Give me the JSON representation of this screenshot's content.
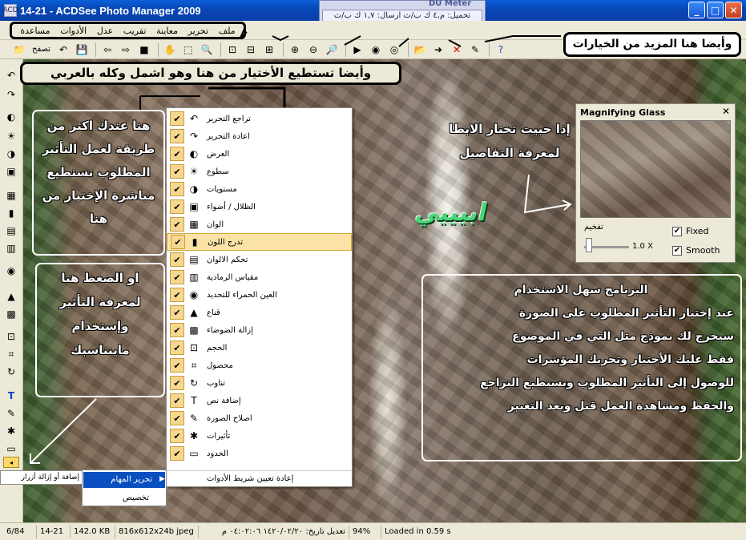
{
  "window": {
    "title": "14-21 - ACDSee Photo Manager 2009",
    "app_icon_label": "ACD",
    "minimize_symbol": "_",
    "maximize_symbol": "□",
    "close_symbol": "✕"
  },
  "du_meter": {
    "title": "DU Meter",
    "readout": "تحميل: م,٤ ك ب/ث ارسال: ١,٧ ك ب/ث"
  },
  "menu": {
    "items": [
      "مساعدة",
      "الأدوات",
      "عدل",
      "تقريب",
      "معاينة",
      "تحرير",
      "ملف"
    ]
  },
  "toolbar": {
    "browse_label": "تصفح",
    "icons": [
      "browse-icon",
      "rotate-left-icon",
      "save-icon",
      "back-icon",
      "forward-icon",
      "stop-icon",
      "hand-icon",
      "select-icon",
      "magnifier-icon",
      "fit-icon",
      "fit-width-icon",
      "actual-size-icon",
      "zoom-in-icon",
      "zoom-out-icon",
      "zoom-icon",
      "slideshow-icon",
      "wallpaper-icon",
      "info-icon",
      "open-folder-icon",
      "move-icon",
      "delete-icon",
      "properties-icon",
      "help-icon"
    ]
  },
  "annotations": {
    "more_options": "وأيضا هنا المزيد من الخيارات",
    "choose_here": "وأيضا تستطيع الأختيار من هنا وهو اشمل وكله بالعربي",
    "more_ways": [
      "هنا عندك اكثر من",
      "طريقة لعمل التأثير",
      "المطلوب تستطيع",
      "مباشرة الإختيار من",
      "هنا"
    ],
    "press_here": [
      "او الضغط هنا",
      "لمعرفة التأثير",
      "وإستخدام",
      "ماينناسبك"
    ],
    "easy": [
      "البرنامج سهل الاستخدام",
      "عند إختيار التأثير المطلوب على الصورة",
      "سيخرج لك نموذج مثل التي في الموضوع",
      "فقط عليك الأختيار وتحريك المؤشرات",
      "للوصول إلى التأثير المطلوب وتستطيع التراجع",
      "والحفظ ومشاهدة العمل قبل وبعد  التغيير"
    ],
    "magnifier_note": [
      "إذا حبيت تختار الابطا",
      "لمعرفة التفاصيل"
    ],
    "green_word": "ابيييي"
  },
  "dropdown": {
    "items": [
      {
        "label": "تراجع التحرير",
        "icon": "undo-icon"
      },
      {
        "label": "اعادة التحرير",
        "icon": "redo-icon"
      },
      {
        "label": "العرض",
        "icon": "exposure-icon"
      },
      {
        "label": "سطوع",
        "icon": "brightness-icon"
      },
      {
        "label": "مستويات",
        "icon": "levels-icon"
      },
      {
        "label": "الظلال / أضواء",
        "icon": "shadows-icon"
      },
      {
        "label": "الوان",
        "icon": "color-icon"
      },
      {
        "label": "تدرج اللون",
        "icon": "histogram-icon"
      },
      {
        "label": "تحكم الالوان",
        "icon": "color-control-icon"
      },
      {
        "label": "مقياس الرمادية",
        "icon": "grayscale-icon"
      },
      {
        "label": "العين الحمراء للتحديد",
        "icon": "red-eye-icon"
      },
      {
        "label": "قناع",
        "icon": "mask-icon"
      },
      {
        "label": "إزالة الضوضاء",
        "icon": "noise-icon"
      },
      {
        "label": "الحجم",
        "icon": "resize-icon"
      },
      {
        "label": "محصول",
        "icon": "crop-icon"
      },
      {
        "label": "تناوب",
        "icon": "rotate-icon"
      },
      {
        "label": "إضافة نص",
        "icon": "text-icon"
      },
      {
        "label": "اصلاح الصورة",
        "icon": "repair-icon"
      },
      {
        "label": "تأثيرات",
        "icon": "effects-icon"
      },
      {
        "label": "الحدود",
        "icon": "borders-icon"
      }
    ],
    "highlighted_index": 7,
    "reset_label": "إعادة تعيين شريط الأدوات"
  },
  "context_menu": {
    "add_remove": "إضافة أو إزالة أزرار",
    "edit_tasks": "تحرير المهام",
    "customize": "تخصيص"
  },
  "magnifier": {
    "title": "Magnifying Glass",
    "zoom_label": "تفخيم",
    "zoom_value": "1.0 X",
    "fixed_label": "Fixed",
    "smooth_label": "Smooth",
    "fixed_checked": true,
    "smooth_checked": true,
    "zoom_level": 1.0
  },
  "statusbar": {
    "position": "6/84",
    "name": "14-21",
    "size": "142.0 KB",
    "dims": "816x612x24b jpeg",
    "modified": "تعديل تاريخ: ١٤٢٠/٠٢/٢٠ ٠٤:٠٢:٠٦ م",
    "zoom": "94%",
    "loaded": "Loaded in 0.59 s"
  },
  "colors": {
    "titlebar": "#0a5fd8",
    "highlight": "#fbe2a6",
    "green_text": "#4cd67a",
    "selection": "#0a4fc0"
  }
}
